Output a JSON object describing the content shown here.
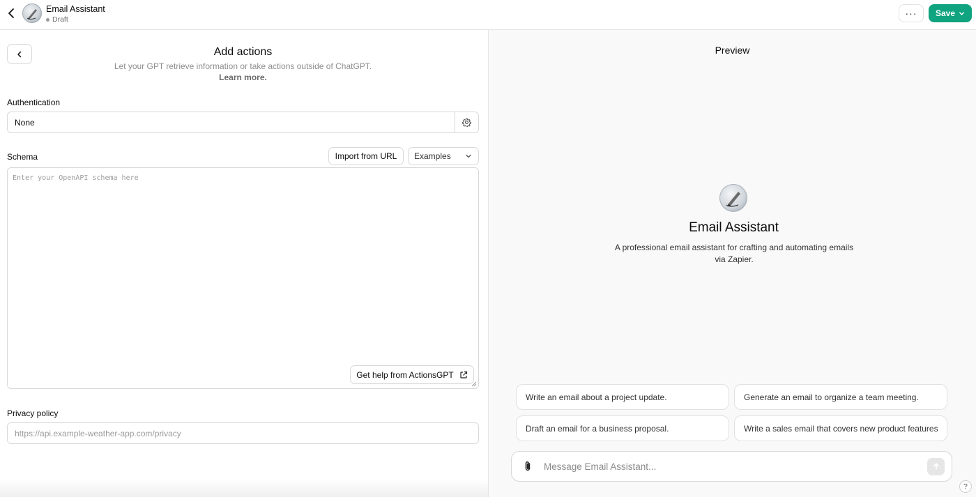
{
  "header": {
    "title": "Email Assistant",
    "status": "Draft",
    "more_label": "···",
    "save_label": "Save"
  },
  "actions": {
    "heading": "Add actions",
    "subtitle": "Let your GPT retrieve information or take actions outside of ChatGPT.",
    "learn_more": "Learn more.",
    "authentication": {
      "label": "Authentication",
      "value": "None"
    },
    "schema": {
      "label": "Schema",
      "import_label": "Import from URL",
      "examples_label": "Examples",
      "placeholder": "Enter your OpenAPI schema here",
      "help_label": "Get help from ActionsGPT"
    },
    "privacy": {
      "label": "Privacy policy",
      "placeholder": "https://api.example-weather-app.com/privacy"
    }
  },
  "preview": {
    "label": "Preview",
    "name": "Email Assistant",
    "description": "A professional email assistant for crafting and automating emails via Zapier.",
    "starters": [
      "Write an email about a project update.",
      "Generate an email to organize a team meeting.",
      "Draft an email for a business proposal.",
      "Write a sales email that covers new product features"
    ],
    "message_placeholder": "Message Email Assistant...",
    "help_label": "?"
  },
  "colors": {
    "accent": "#10a37f",
    "panel_bg": "#f9f9f9",
    "border": "#d9d9d9"
  },
  "icons": [
    "chevron-left-icon",
    "gear-icon",
    "chevron-down-icon",
    "external-link-icon",
    "paperclip-icon",
    "arrow-up-icon"
  ]
}
